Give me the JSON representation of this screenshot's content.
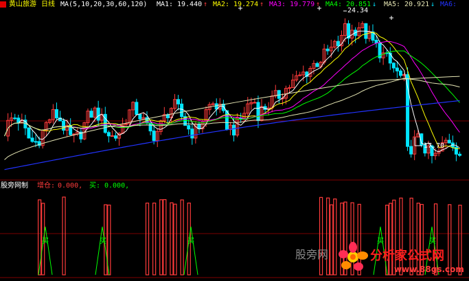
{
  "colors": {
    "bg": "#000000",
    "up": "#ff3b3b",
    "down": "#00e5ff",
    "ma5": "#ffffff",
    "ma10": "#ffff00",
    "ma20": "#ff00ff",
    "ma30": "#00ff00",
    "ma60": "#e6e6b4",
    "ma120": "#2233ff",
    "label": "#ffffff",
    "name": "#ffff00",
    "grid": "#7a0000"
  },
  "header": {
    "stock_name": "黄山旅游",
    "period": "日线",
    "ma_params": "MA(5,10,20,30,60,120)",
    "ma1_label": "MA1:",
    "ma1_value": "19.440",
    "ma2_label": "MA2:",
    "ma2_value": "19.274",
    "ma3_label": "MA3:",
    "ma3_value": "19.779",
    "ma4_label": "MA4:",
    "ma4_value": "20.851",
    "ma5_label": "MA5:",
    "ma5_value": "20.921",
    "ma6_label": "MA6:",
    "up_arrow": "↑",
    "down_arrow": "↓"
  },
  "annotations": {
    "high": "24.34",
    "low": "17.70"
  },
  "indicator": {
    "name": "股旁网制",
    "field1_label": "增仓:",
    "field1_value": "0.000,",
    "field2_label": "买:",
    "field2_value": "0.000,",
    "buy_marker": "买"
  },
  "watermark": {
    "site_cn": "股旁网",
    "brand": "分析家公式网",
    "url": "www.88gs.com"
  },
  "chart_data": {
    "type": "candlestick",
    "price_high": 24.34,
    "price_low": 17.7,
    "indicator_signal": [
      0,
      0,
      0,
      0,
      0,
      0,
      0,
      0,
      0,
      0,
      1,
      1,
      0,
      0,
      0,
      0,
      0,
      1,
      0,
      0,
      0,
      0,
      0,
      0,
      0,
      0,
      0,
      0,
      0,
      1,
      1,
      0,
      0,
      0,
      0,
      0,
      0,
      0,
      0,
      0,
      0,
      1,
      0,
      1,
      0,
      1,
      1,
      0,
      1,
      1,
      0,
      1,
      0,
      1,
      0,
      0,
      0,
      0,
      0,
      0,
      0,
      0,
      0,
      0,
      0,
      0,
      0,
      0,
      0,
      0,
      0,
      0,
      0,
      0,
      0,
      0,
      0,
      0,
      0,
      0,
      0,
      0,
      0,
      0,
      0,
      0,
      0,
      0,
      0,
      0,
      0,
      1,
      0,
      1,
      1,
      1,
      0,
      1,
      1,
      0,
      1,
      0,
      1,
      0,
      0,
      0,
      0,
      0,
      0,
      0,
      1,
      1,
      1,
      0,
      1,
      0,
      0,
      1,
      0,
      1,
      1,
      0,
      0,
      0,
      1,
      0,
      0,
      0,
      1,
      0,
      0,
      1
    ]
  }
}
